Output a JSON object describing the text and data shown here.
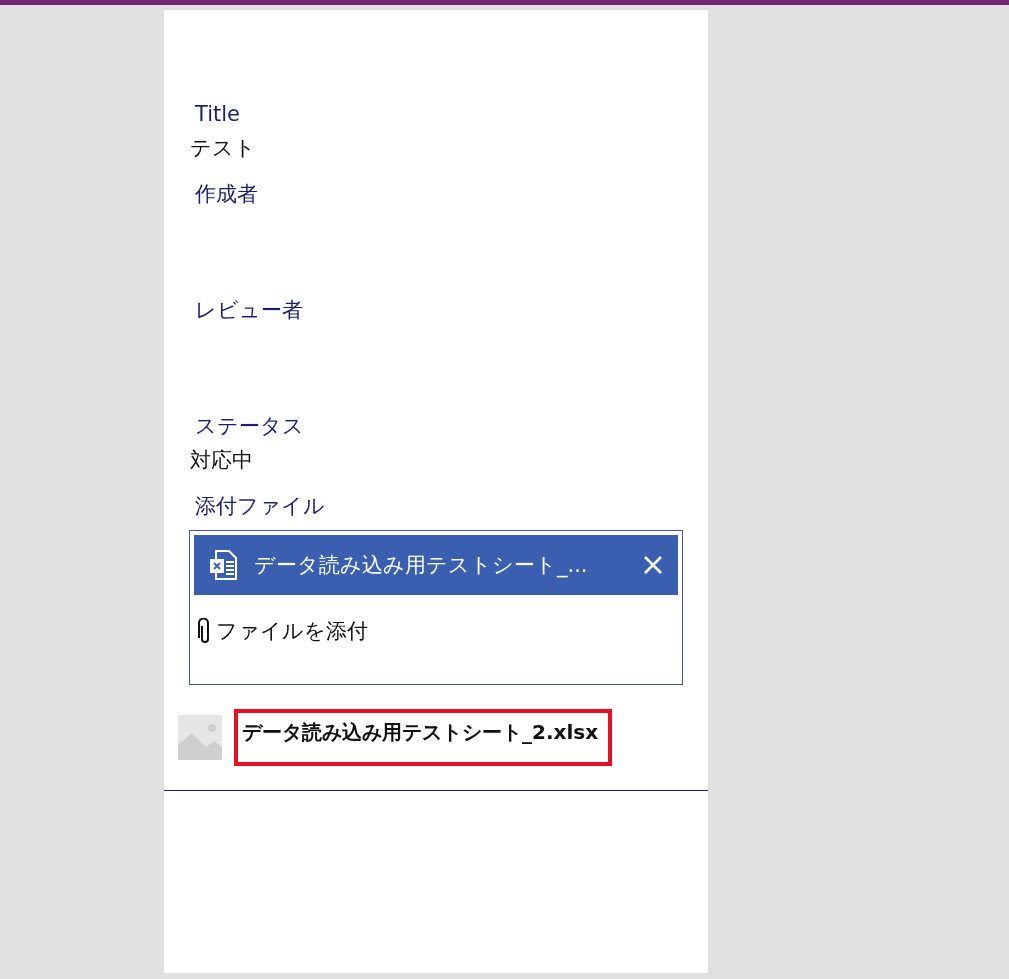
{
  "form": {
    "fields": [
      {
        "label": "Title",
        "value": "テスト"
      },
      {
        "label": "作成者"
      },
      {
        "label": "レビュー者"
      },
      {
        "label": "ステータス",
        "value": "対応中"
      }
    ],
    "attachments": {
      "label": "添付ファイル",
      "files": [
        {
          "name": "データ読み込み用テストシート_..."
        }
      ],
      "add_label": "ファイルを添付"
    },
    "gallery_item": {
      "file_name": "データ読み込み用テストシート_2.xlsx",
      "highlighted": true
    }
  }
}
